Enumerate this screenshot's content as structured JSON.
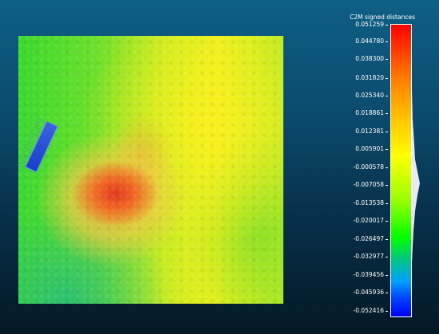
{
  "legend": {
    "title": "C2M signed distances",
    "ticks": [
      "0.051259",
      "0.044780",
      "0.038300",
      "0.031820",
      "0.025340",
      "0.018861",
      "0.012381",
      "0.005901",
      "-0.000578",
      "-0.007058",
      "-0.013538",
      "-0.020017",
      "-0.026497",
      "-0.032977",
      "-0.039456",
      "-0.045936",
      "-0.052416"
    ]
  },
  "colors": {
    "background_top": "#0e5f86",
    "background_bottom": "#041825",
    "scale_max": "#ff0000",
    "scale_mid": "#ffff00",
    "scale_zero": "#00ff00",
    "scale_min": "#0000ff"
  }
}
